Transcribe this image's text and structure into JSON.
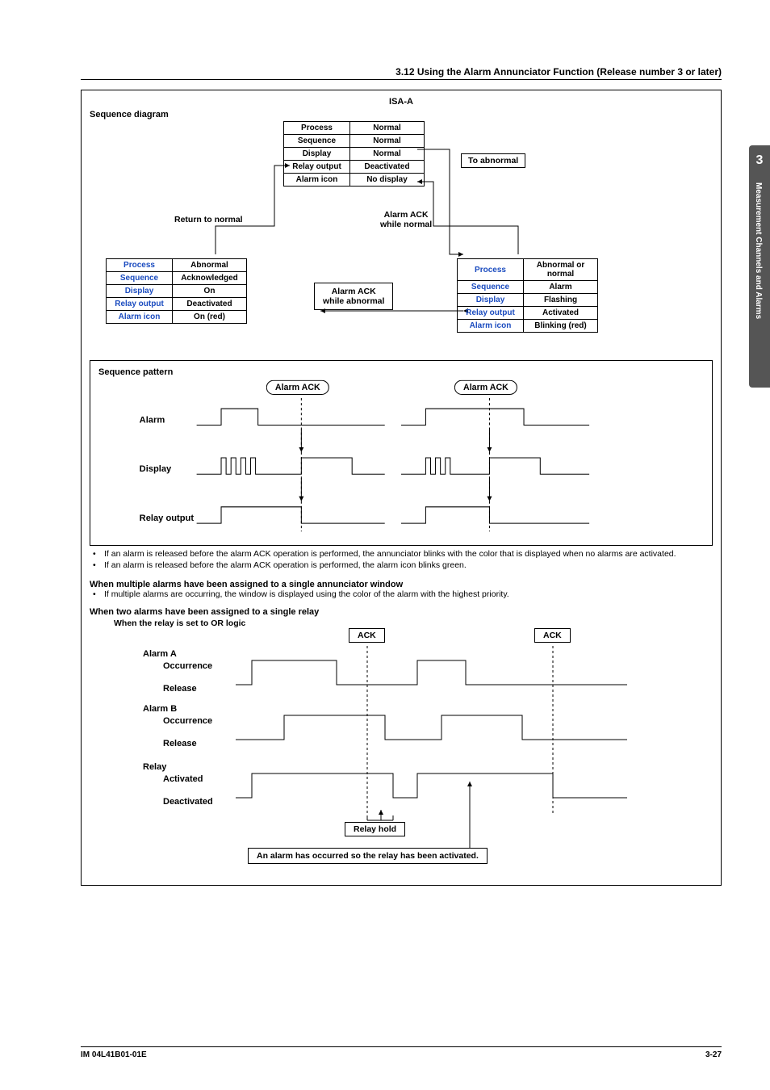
{
  "header": {
    "section": "3.12  Using the Alarm Annunciator Function (Release number 3 or later)"
  },
  "side": {
    "num": "3",
    "text": "Measurement Channels and Alarms"
  },
  "isa": {
    "title": "ISA-A",
    "seq_diag": "Sequence diagram",
    "top_table": [
      [
        "Process",
        "Normal"
      ],
      [
        "Sequence",
        "Normal"
      ],
      [
        "Display",
        "Normal"
      ],
      [
        "Relay output",
        "Deactivated"
      ],
      [
        "Alarm icon",
        "No display"
      ]
    ],
    "to_abnormal": "To abnormal",
    "return_normal": "Return to normal",
    "ack_normal1": "Alarm ACK",
    "ack_normal2": "while normal",
    "ack_abn1": "Alarm ACK",
    "ack_abn2": "while abnormal",
    "left_table": [
      [
        "Process",
        "Abnormal"
      ],
      [
        "Sequence",
        "Acknowledged"
      ],
      [
        "Display",
        "On"
      ],
      [
        "Relay output",
        "Deactivated"
      ],
      [
        "Alarm icon",
        "On (red)"
      ]
    ],
    "right_table": [
      [
        "Process",
        "Abnormal or normal"
      ],
      [
        "Sequence",
        "Alarm"
      ],
      [
        "Display",
        "Flashing"
      ],
      [
        "Relay output",
        "Activated"
      ],
      [
        "Alarm icon",
        "Blinking (red)"
      ]
    ]
  },
  "sp": {
    "title": "Sequence pattern",
    "ack": "Alarm ACK",
    "rows": [
      "Alarm",
      "Display",
      "Relay output"
    ]
  },
  "bullets": {
    "b1": "If an alarm is released before the alarm ACK operation is performed, the annunciator blinks with the color that is displayed when no alarms are activated.",
    "b2": "If an alarm is released before the alarm ACK operation is performed, the alarm icon blinks green."
  },
  "multi": {
    "head": "When multiple alarms have been assigned to a single annunciator window",
    "text": "If multiple alarms are occurring, the window is displayed using the color of the alarm with the highest priority."
  },
  "relay": {
    "head": "When two alarms have been assigned to a single relay",
    "sub": "When the relay is set to OR logic",
    "ack": "ACK",
    "labels": {
      "alarm_a": "Alarm A",
      "occ": "Occurrence",
      "rel": "Release",
      "alarm_b": "Alarm B",
      "relay": "Relay",
      "act": "Activated",
      "deact": "Deactivated",
      "hold": "Relay hold",
      "note": "An alarm has occurred so the relay has been activated."
    }
  },
  "footer": {
    "left": "IM 04L41B01-01E",
    "right": "3-27"
  }
}
